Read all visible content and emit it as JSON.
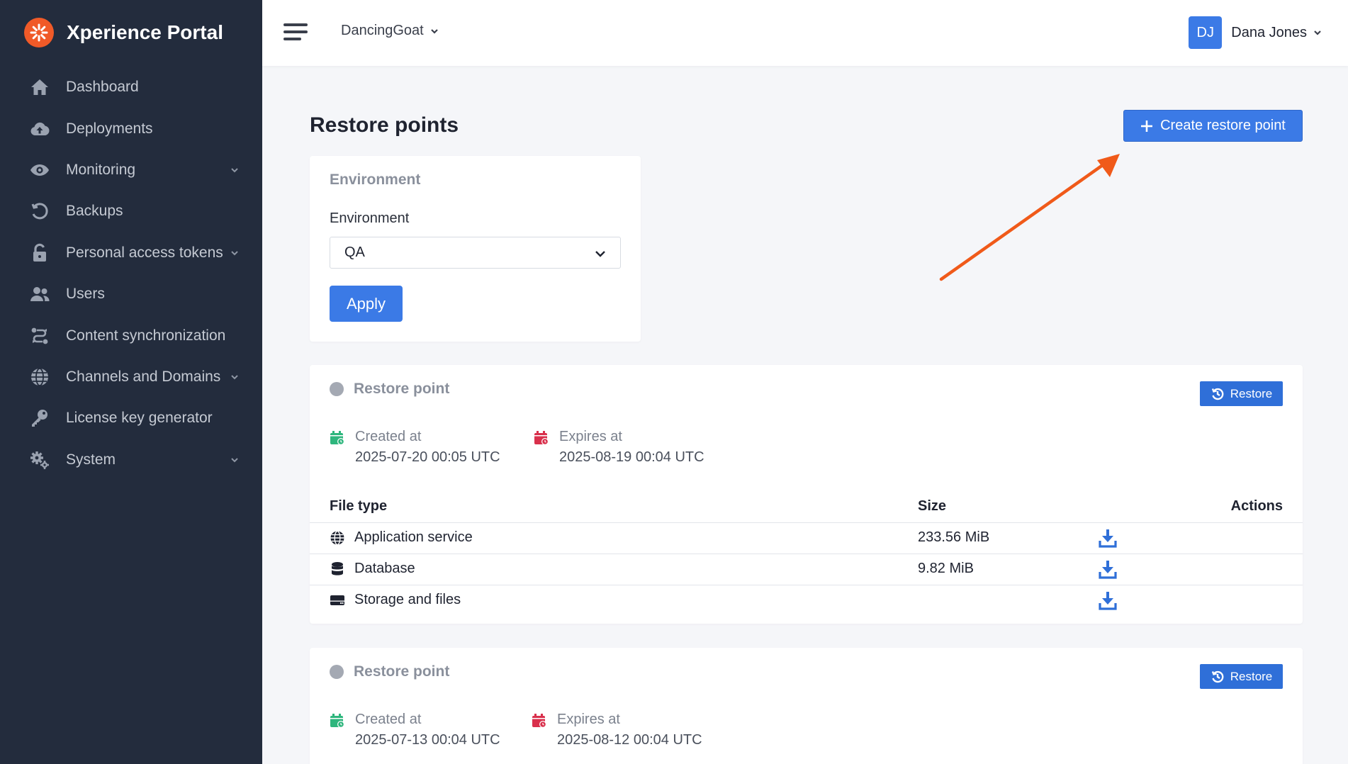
{
  "app": {
    "title": "Xperience Portal"
  },
  "sidebar": {
    "items": [
      {
        "label": "Dashboard",
        "icon": "home-icon",
        "has_chevron": false
      },
      {
        "label": "Deployments",
        "icon": "cloud-upload-icon",
        "has_chevron": false
      },
      {
        "label": "Monitoring",
        "icon": "eye-icon",
        "has_chevron": true
      },
      {
        "label": "Backups",
        "icon": "history-icon",
        "has_chevron": false
      },
      {
        "label": "Personal access tokens",
        "icon": "unlock-icon",
        "has_chevron": true
      },
      {
        "label": "Users",
        "icon": "users-icon",
        "has_chevron": false
      },
      {
        "label": "Content synchronization",
        "icon": "sync-icon",
        "has_chevron": false
      },
      {
        "label": "Channels and Domains",
        "icon": "globe-icon",
        "has_chevron": true
      },
      {
        "label": "License key generator",
        "icon": "key-icon",
        "has_chevron": false
      },
      {
        "label": "System",
        "icon": "cogs-icon",
        "has_chevron": true
      }
    ]
  },
  "header": {
    "tenant": "DancingGoat",
    "user": {
      "initials": "DJ",
      "name": "Dana Jones"
    }
  },
  "main": {
    "title": "Restore points",
    "create_button": "Create restore point",
    "filter": {
      "heading": "Environment",
      "label": "Environment",
      "selected": "QA",
      "apply_button": "Apply"
    },
    "table_headers": {
      "file_type": "File type",
      "size": "Size",
      "actions": "Actions"
    },
    "restore_points": [
      {
        "title": "Restore point",
        "restore_button": "Restore",
        "created_label": "Created at",
        "created_value": "2025-07-20 00:05 UTC",
        "expires_label": "Expires at",
        "expires_value": "2025-08-19 00:04 UTC",
        "files": [
          {
            "name": "Application service",
            "size": "233.56 MiB",
            "icon": "globe-icon"
          },
          {
            "name": "Database",
            "size": "9.82 MiB",
            "icon": "database-icon"
          },
          {
            "name": "Storage and files",
            "size": "",
            "icon": "hdd-icon"
          }
        ]
      },
      {
        "title": "Restore point",
        "restore_button": "Restore",
        "created_label": "Created at",
        "created_value": "2025-07-13 00:04 UTC",
        "expires_label": "Expires at",
        "expires_value": "2025-08-12 00:04 UTC"
      }
    ]
  },
  "colors": {
    "sidebar_bg": "#232c3d",
    "accent": "#3b7ae6",
    "brand": "#f05a28",
    "annotation_arrow": "#f05a1a",
    "created_icon": "#2eb67d",
    "expires_icon": "#d9304c"
  }
}
